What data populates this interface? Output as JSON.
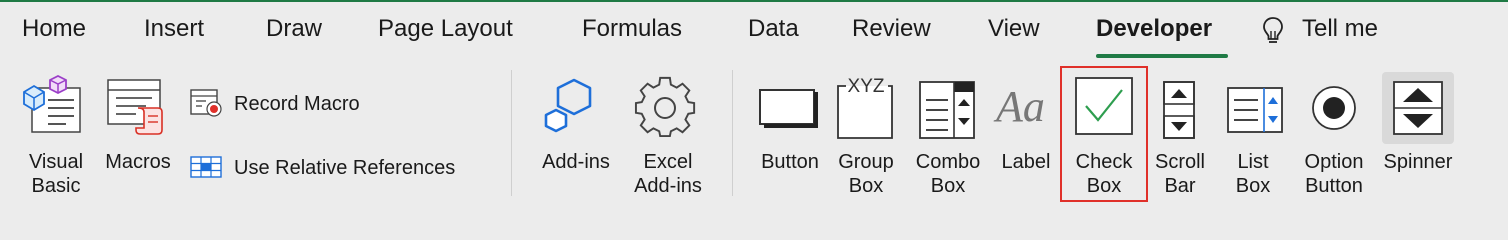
{
  "tabs": [
    {
      "label": "Home"
    },
    {
      "label": "Insert"
    },
    {
      "label": "Draw"
    },
    {
      "label": "Page Layout"
    },
    {
      "label": "Formulas"
    },
    {
      "label": "Data"
    },
    {
      "label": "Review"
    },
    {
      "label": "View"
    },
    {
      "label": "Developer",
      "active": true
    }
  ],
  "tell_me": "Tell me",
  "code_group": {
    "visual_basic": "Visual\nBasic",
    "macros": "Macros",
    "record_macro": "Record Macro",
    "relative_refs": "Use Relative References"
  },
  "addins_group": {
    "addins": "Add-ins",
    "excel_addins": "Excel\nAdd-ins"
  },
  "controls_group": {
    "button": "Button",
    "group_box": "Group\nBox",
    "combo_box": "Combo\nBox",
    "label": "Label",
    "check_box": "Check\nBox",
    "scroll_bar": "Scroll\nBar",
    "list_box": "List\nBox",
    "option_button": "Option\nButton",
    "spinner": "Spinner"
  },
  "icons": {
    "xyz": "XYZ",
    "aa": "Aa"
  },
  "colors": {
    "accent": "#1f7a45",
    "highlight": "#e0302a",
    "blue": "#1e6fd9",
    "checkmark": "#2e9e4f"
  }
}
